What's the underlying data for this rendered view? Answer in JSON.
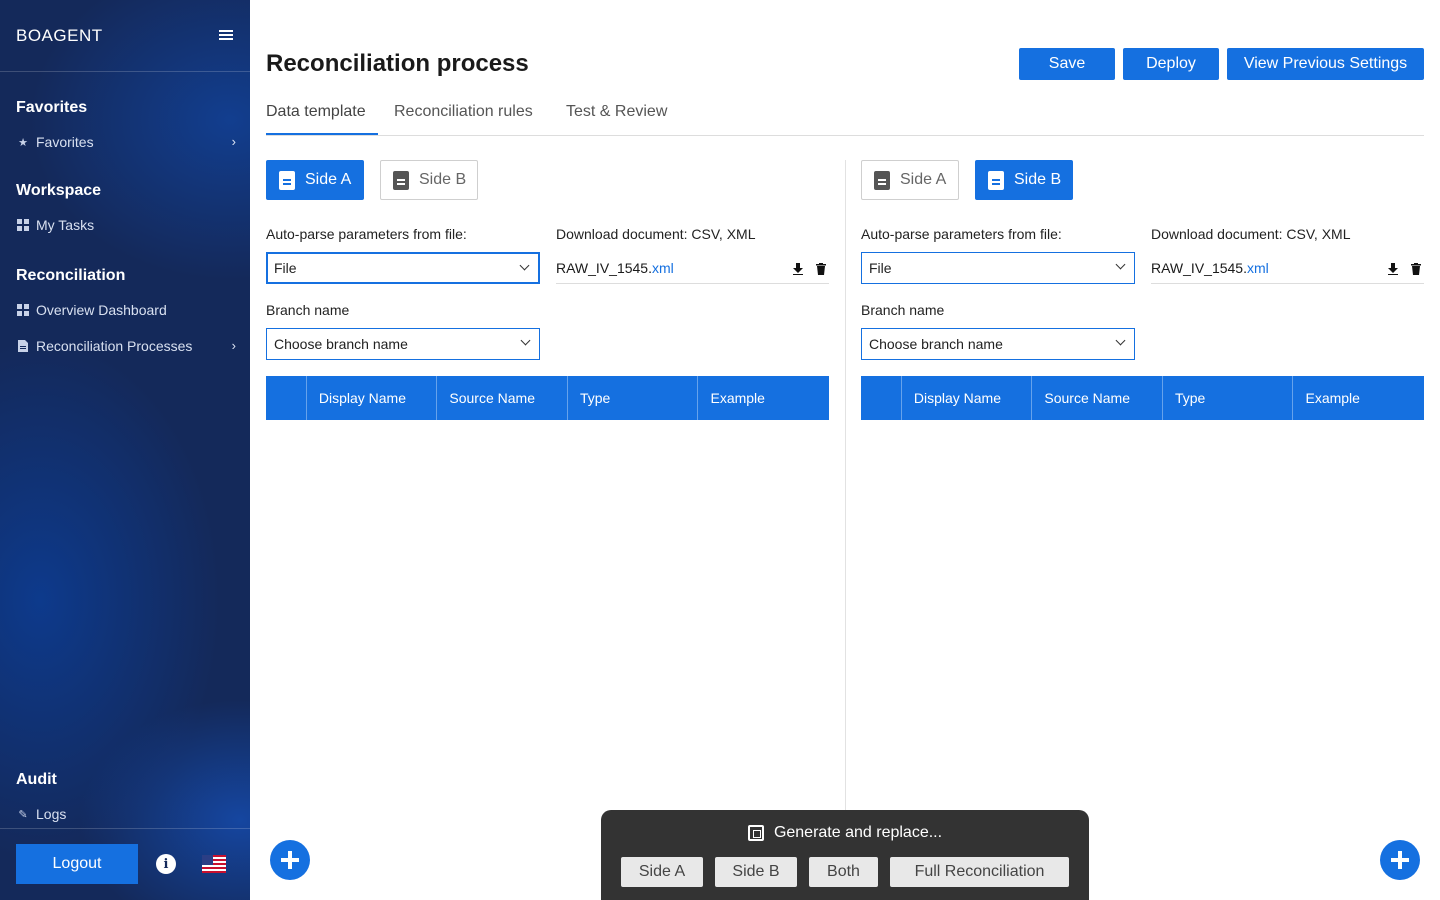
{
  "sidebar": {
    "brand": "BOAGENT",
    "sections": {
      "favorites": {
        "title": "Favorites",
        "items": [
          {
            "label": "Favorites",
            "icon": "star-icon"
          }
        ]
      },
      "workspace": {
        "title": "Workspace",
        "items": [
          {
            "label": "My Tasks",
            "icon": "dashboard-icon"
          }
        ]
      },
      "reconciliation": {
        "title": "Reconciliation",
        "items": [
          {
            "label": "Overview Dashboard",
            "icon": "dashboard-icon"
          },
          {
            "label": "Reconciliation Processes",
            "icon": "document-icon"
          }
        ]
      },
      "audit": {
        "title": "Audit",
        "items": [
          {
            "label": "Logs",
            "icon": "pencil-icon"
          }
        ]
      }
    },
    "logout_label": "Logout",
    "info_glyph": "i"
  },
  "header": {
    "title": "Reconciliation process",
    "buttons": {
      "save": "Save",
      "deploy": "Deploy",
      "view_previous": "View Previous Settings"
    }
  },
  "tabs": [
    {
      "label": "Data template",
      "active": true
    },
    {
      "label": "Reconciliation rules",
      "active": false
    },
    {
      "label": "Test & Review",
      "active": false
    }
  ],
  "panels": {
    "left": {
      "toggle": {
        "side_a": "Side A",
        "side_b": "Side B",
        "selected": "Side A"
      },
      "auto_parse_label": "Auto-parse parameters from file:",
      "file_select_value": "File",
      "download_label": "Download document: CSV, XML",
      "file_name": "RAW_IV_1545.",
      "file_ext": "xml",
      "branch_label": "Branch name",
      "branch_placeholder": "Choose branch name",
      "columns": [
        "Display Name",
        "Source Name",
        "Type",
        "Example"
      ]
    },
    "right": {
      "toggle": {
        "side_a": "Side A",
        "side_b": "Side B",
        "selected": "Side B"
      },
      "auto_parse_label": "Auto-parse parameters from file:",
      "file_select_value": "File",
      "download_label": "Download document: CSV, XML",
      "file_name": "RAW_IV_1545.",
      "file_ext": "xml",
      "branch_label": "Branch name",
      "branch_placeholder": "Choose branch name",
      "columns": [
        "Display Name",
        "Source Name",
        "Type",
        "Example"
      ]
    }
  },
  "generate": {
    "title": "Generate and replace...",
    "buttons": [
      "Side A",
      "Side B",
      "Both",
      "Full Reconciliation"
    ]
  },
  "colors": {
    "accent": "#1570e0",
    "sidebar_bg": "#14295a",
    "panel_dark": "#333333"
  }
}
